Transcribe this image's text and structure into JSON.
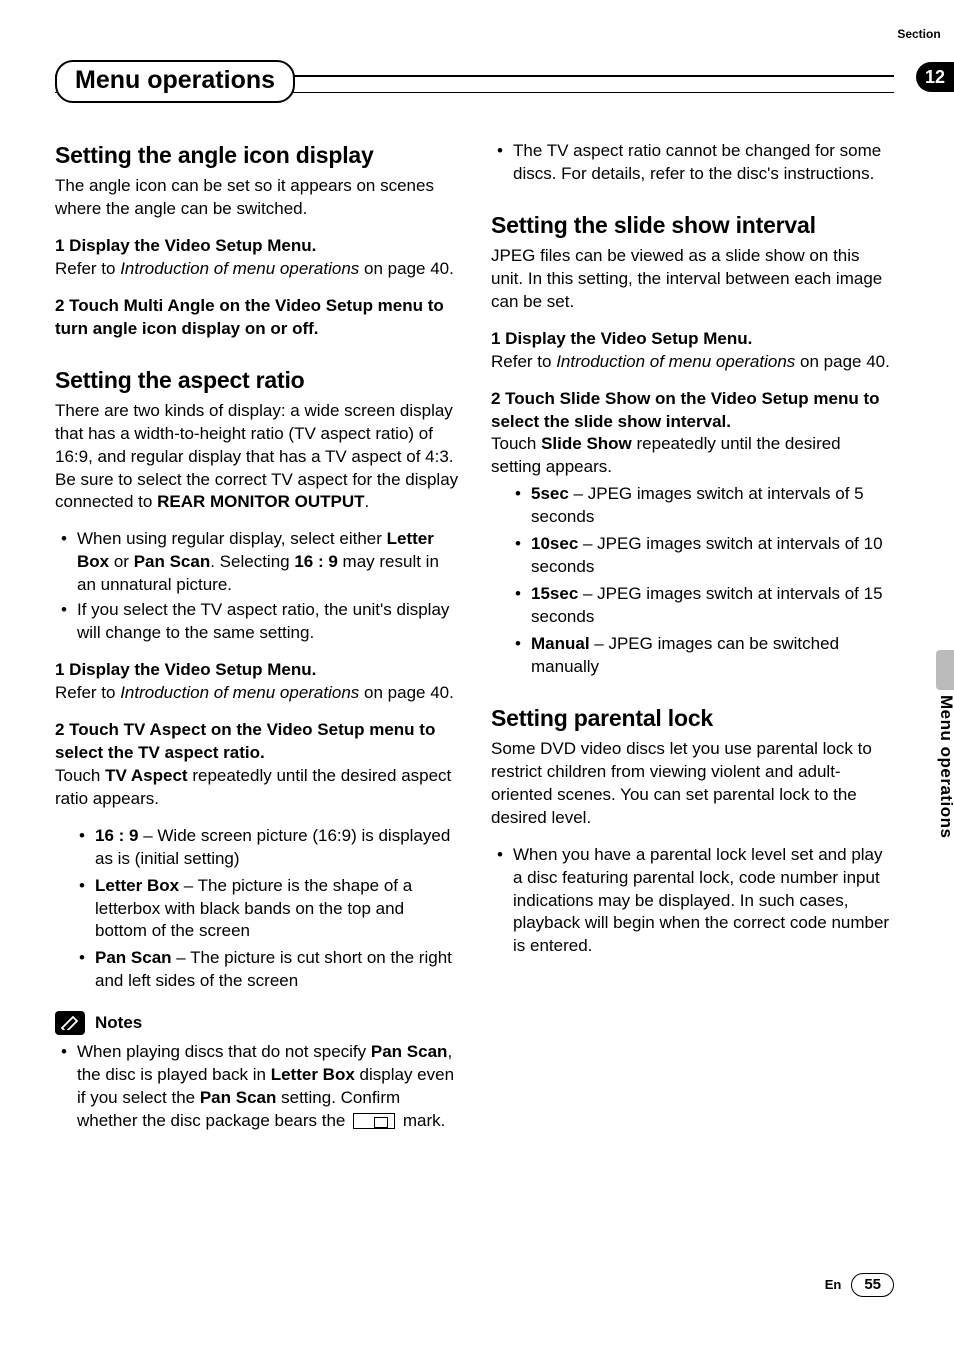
{
  "header": {
    "section_label": "Section",
    "section_number": "12",
    "title": "Menu operations"
  },
  "sidetab": {
    "label": "Menu operations"
  },
  "footer": {
    "lang": "En",
    "page": "55"
  },
  "col1": {
    "h_angle": "Setting the angle icon display",
    "angle_intro": "The angle icon can be set so it appears on scenes where the angle can be switched.",
    "step1_head": "1   Display the Video Setup Menu.",
    "step1_body_a": "Refer to ",
    "step1_body_ref": "Introduction of menu operations",
    "step1_body_b": " on page 40.",
    "step2_head": "2   Touch Multi Angle on the Video Setup menu to turn angle icon display on or off.",
    "h_aspect": "Setting the aspect ratio",
    "aspect_intro_a": "There are two kinds of display: a wide screen display that has a width-to-height ratio (TV aspect ratio) of 16:9, and regular display that has a TV aspect of 4:3. Be sure to select the correct TV aspect for the display connected to ",
    "aspect_intro_bold": "REAR MONITOR OUTPUT",
    "aspect_intro_end": ".",
    "aspect_b1_a": "When using regular display, select either ",
    "aspect_b1_b1": "Letter Box",
    "aspect_b1_b": " or ",
    "aspect_b1_b2": "Pan Scan",
    "aspect_b1_c": ". Selecting ",
    "aspect_b1_b3": "16 : 9",
    "aspect_b1_d": " may result in an unnatural picture.",
    "aspect_b2": "If you select the TV aspect ratio, the unit's display will change to the same setting.",
    "aspect_s1_head": "1   Display the Video Setup Menu.",
    "aspect_s1_body_a": "Refer to ",
    "aspect_s1_ref": "Introduction of menu operations",
    "aspect_s1_body_b": " on page 40.",
    "aspect_s2_head": "2   Touch TV Aspect on the Video Setup menu to select the TV aspect ratio.",
    "aspect_s2_body_a": "Touch ",
    "aspect_s2_bold": "TV Aspect",
    "aspect_s2_body_b": " repeatedly until the desired aspect ratio appears.",
    "opt1_b": "16 : 9",
    "opt1_t": " – Wide screen picture (16:9) is displayed as is (initial setting)",
    "opt2_b": "Letter Box",
    "opt2_t": " – The picture is the shape of a letterbox with black bands on the top and bottom of the screen",
    "opt3_b": "Pan Scan",
    "opt3_t": " – The picture is cut short on the right and left sides of the screen",
    "notes_title": "Notes",
    "note1_a": "When playing discs that do not specify ",
    "note1_b1": "Pan Scan",
    "note1_b": ", the disc is played back in ",
    "note1_b2": "Letter Box",
    "note1_c": " display even if you select the ",
    "note1_b3": "Pan Scan",
    "note1_d": " setting. Confirm whether the disc package bears the ",
    "note1_e": " mark."
  },
  "col2": {
    "tv_note": "The TV aspect ratio cannot be changed for some discs. For details, refer to the disc's instructions.",
    "h_slide": "Setting the slide show interval",
    "slide_intro": "JPEG files can be viewed as a slide show on this unit. In this setting, the interval between each image can be set.",
    "slide_s1_head": "1   Display the Video Setup Menu.",
    "slide_s1_body_a": "Refer to ",
    "slide_s1_ref": "Introduction of menu operations",
    "slide_s1_body_b": " on page 40.",
    "slide_s2_head": "2   Touch Slide Show on the Video Setup menu to select the slide show interval.",
    "slide_s2_body_a": "Touch ",
    "slide_s2_bold": "Slide Show",
    "slide_s2_body_b": " repeatedly until the desired setting appears.",
    "sopt1_b": "5sec",
    "sopt1_t": " – JPEG images switch at intervals of 5 seconds",
    "sopt2_b": "10sec",
    "sopt2_t": " – JPEG images switch at intervals of 10 seconds",
    "sopt3_b": "15sec",
    "sopt3_t": " – JPEG images switch at intervals of 15 seconds",
    "sopt4_b": "Manual",
    "sopt4_t": " – JPEG images can be switched manually",
    "h_parental": "Setting parental lock",
    "parental_intro": "Some DVD video discs let you use parental lock to restrict children from viewing violent and adult-oriented scenes. You can set parental lock to the desired level.",
    "parental_b1": "When you have a parental lock level set and play a disc featuring parental lock, code number input indications may be displayed. In such cases, playback will begin when the correct code number is entered."
  }
}
